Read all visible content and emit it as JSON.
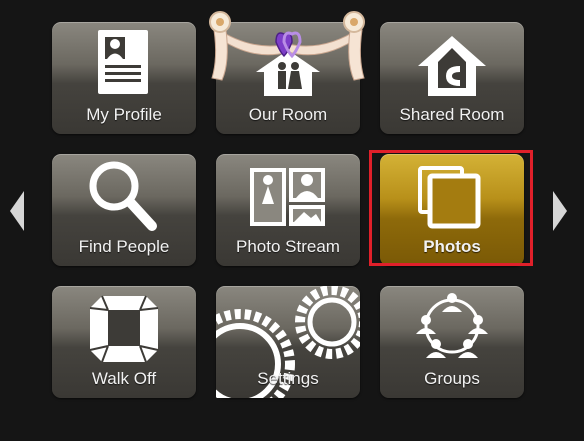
{
  "menu": {
    "tiles": [
      {
        "label": "My Profile",
        "icon": "profile-card-icon"
      },
      {
        "label": "Our Room",
        "icon": "wedding-arch-couple-icon"
      },
      {
        "label": "Shared Room",
        "icon": "shared-house-icon"
      },
      {
        "label": "Find People",
        "icon": "magnifier-icon"
      },
      {
        "label": "Photo Stream",
        "icon": "photo-collage-icon"
      },
      {
        "label": "Photos",
        "icon": "stacked-photos-icon",
        "selected": true
      },
      {
        "label": "Walk Off",
        "icon": "walk-off-stage-icon"
      },
      {
        "label": "Settings",
        "icon": "gears-icon"
      },
      {
        "label": "Groups",
        "icon": "group-network-icon"
      }
    ]
  },
  "nav": {
    "prev_icon": "left-arrow-icon",
    "next_icon": "right-arrow-icon"
  },
  "colors": {
    "background": "#151515",
    "tile": "#6b6860",
    "selected_tile": "#b8901a",
    "selection_border": "#e0202a"
  }
}
